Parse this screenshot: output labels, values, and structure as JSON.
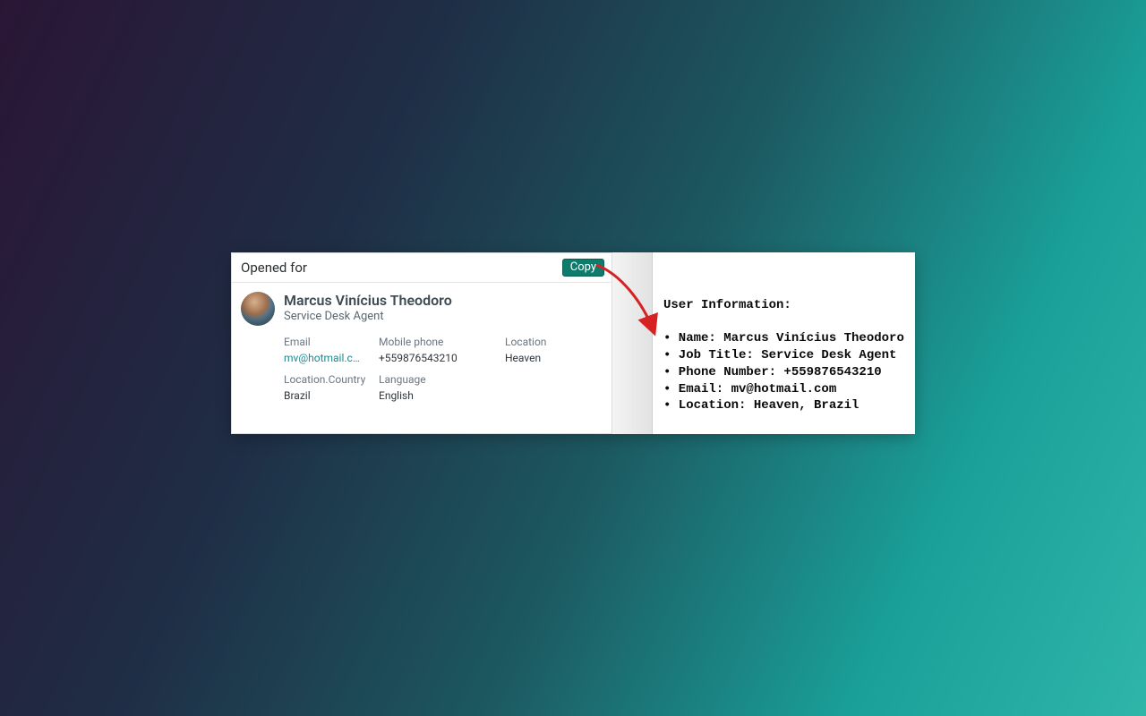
{
  "card": {
    "header_title": "Opened for",
    "copy_label": "Copy",
    "user": {
      "name": "Marcus Vinícius Theodoro",
      "job_title": "Service Desk Agent",
      "email_label": "Email",
      "email_value": "mv@hotmail.c…",
      "mobile_label": "Mobile phone",
      "mobile_value": "+559876543210",
      "location_label": "Location",
      "location_value": "Heaven",
      "country_label": "Location.Country",
      "country_value": "Brazil",
      "language_label": "Language",
      "language_value": "English"
    }
  },
  "output": {
    "heading": "User Information:",
    "lines": {
      "l0": "• Name: Marcus Vinícius Theodoro",
      "l1": "• Job Title: Service Desk Agent",
      "l2": "• Phone Number: +559876543210",
      "l3": "• Email: mv@hotmail.com",
      "l4": "• Location: Heaven, Brazil"
    }
  }
}
